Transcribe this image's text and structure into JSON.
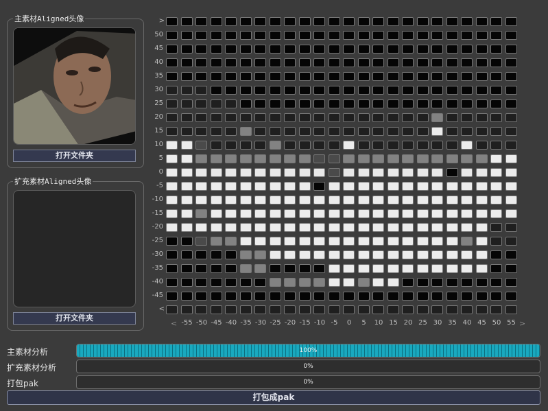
{
  "main_group": {
    "title": "主素材Aligned头像",
    "button": "打开文件夹"
  },
  "extra_group": {
    "title": "扩充素材Aligned头像",
    "button": "打开文件夹"
  },
  "grid": {
    "y_labels": [
      "50",
      "45",
      "40",
      "35",
      "30",
      "25",
      "20",
      "15",
      "10",
      "5",
      "0",
      "-5",
      "-10",
      "-15",
      "-20",
      "-25",
      "-30",
      "-35",
      "-40",
      "-45"
    ],
    "x_labels": [
      "-55",
      "-50",
      "-45",
      "-40",
      "-35",
      "-30",
      "-25",
      "-20",
      "-15",
      "-10",
      "-5",
      "0",
      "5",
      "10",
      "15",
      "20",
      "25",
      "30",
      "35",
      "40",
      "45",
      "50",
      "55"
    ],
    "rows": [
      "000000000000000000000000",
      "000000000000000000000000",
      "000000000000000000000000",
      "000000000000000000000000",
      "000000000000000000000000",
      "111000000000000000000000",
      "111110000000000000000000",
      "111111111111111111211111",
      "111112111111111111611111",
      "663111121111611111116111",
      "662222222233222222222266",
      "665555555553555555505566",
      "666666666646666666666666",
      "666666666666666666666666",
      "662666666666666666666666",
      "666666666666666666666611",
      "003226666666666666662611",
      "000002266666666666666600",
      "000002200006666666666600",
      "000000022226626600000000",
      "000000000000000000000000",
      "111111111111111111111111"
    ],
    "legend": {
      "0": "#050505",
      "1": "#1f1f1f",
      "2": "#828282",
      "3": "#4a4a4a",
      "5": "#e8e8e8",
      "6": "#ececec"
    }
  },
  "progress": [
    {
      "label": "主素材分析",
      "text": "100%",
      "value": 100
    },
    {
      "label": "扩充素材分析",
      "text": "0%",
      "value": 0
    },
    {
      "label": "打包pak",
      "text": "0%",
      "value": 0
    }
  ],
  "pack_button": "打包成pak"
}
